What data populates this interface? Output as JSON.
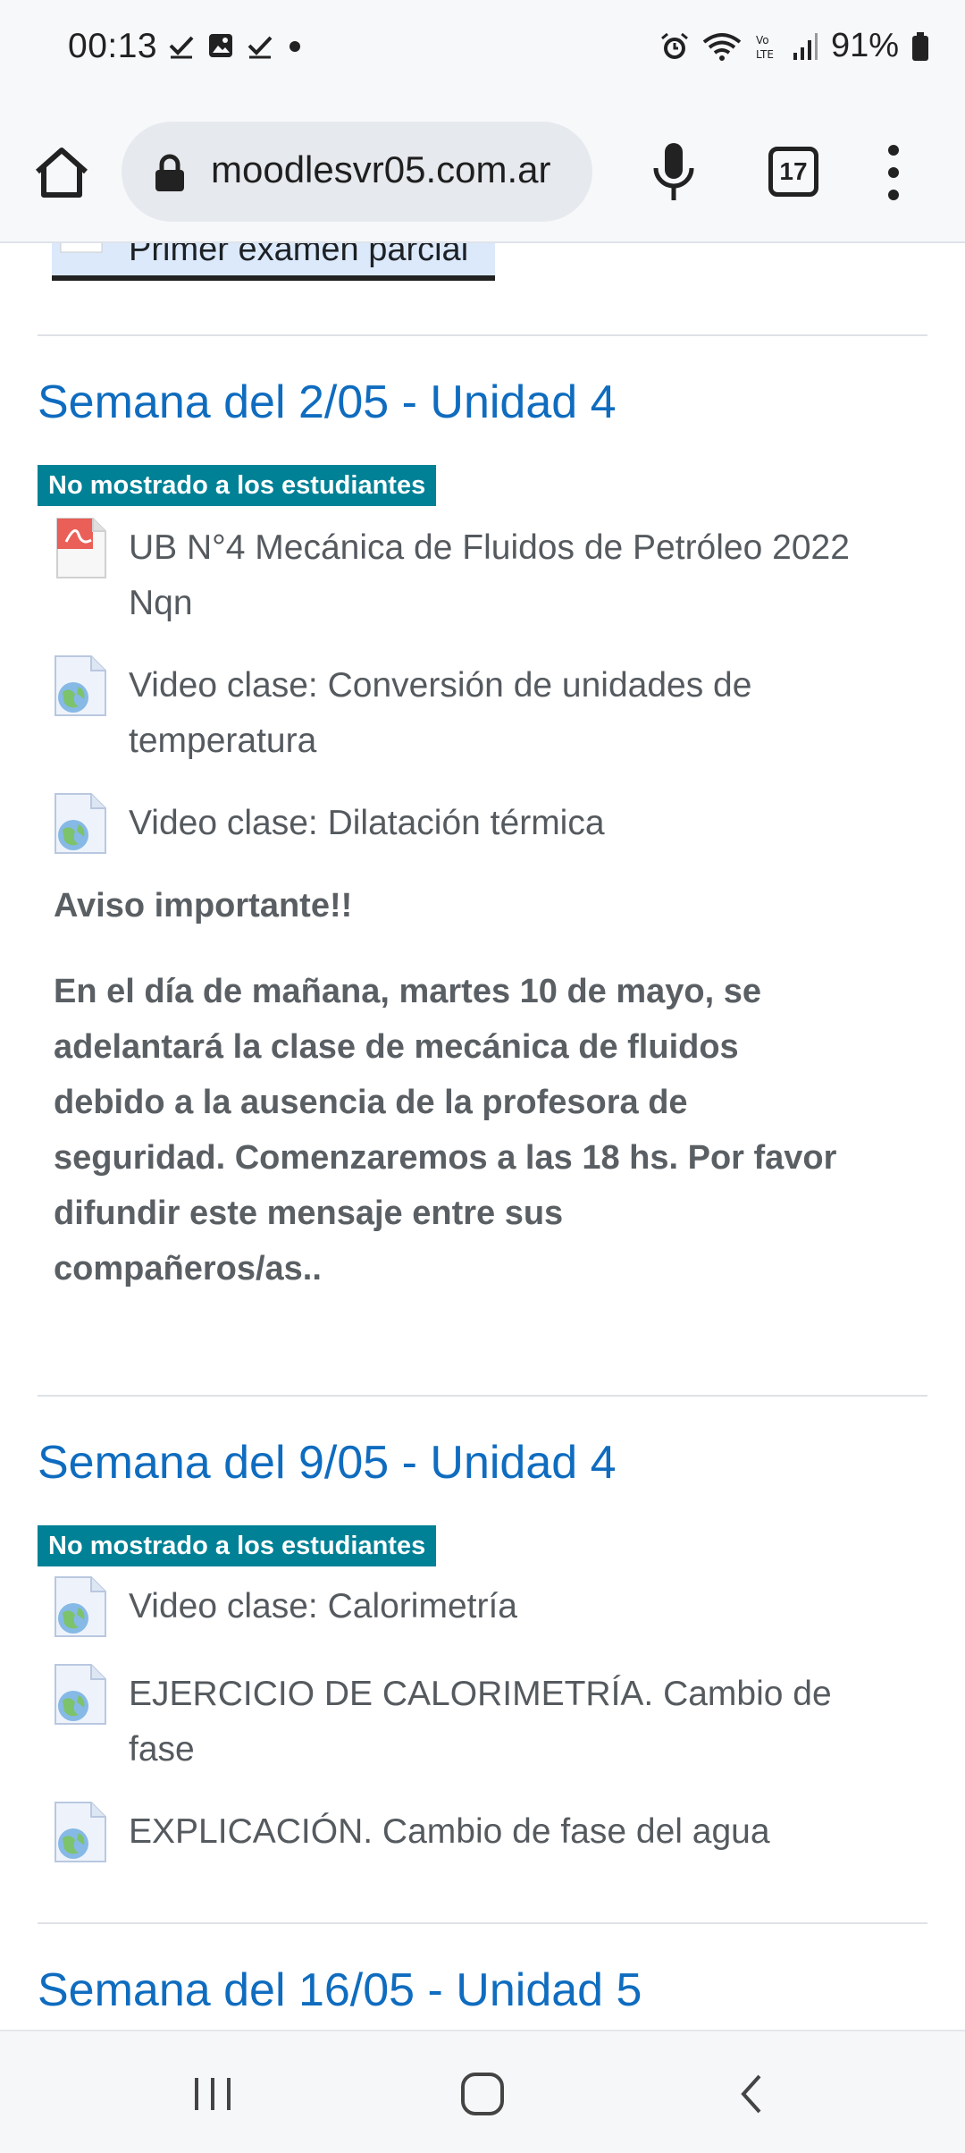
{
  "status_bar": {
    "time": "00:13",
    "battery_percent": "91%",
    "left_icons": [
      "check-icon",
      "image-icon",
      "check-icon",
      "dot-icon"
    ],
    "right_icons": [
      "alarm-icon",
      "wifi-icon",
      "volte-icon",
      "signal-icon",
      "battery-icon"
    ]
  },
  "browser": {
    "url": "moodlesvr05.com.ar",
    "tab_count": "17"
  },
  "course": {
    "previous_item": "Primer examen parcial",
    "sections": [
      {
        "title": "Semana del 2/05 - Unidad 4",
        "badge": "No mostrado a los estudiantes",
        "activities": [
          {
            "icon": "pdf-icon",
            "label": "UB N°4 Mecánica de Fluidos de Petróleo 2022 Nqn"
          },
          {
            "icon": "url-icon",
            "label": "Video clase: Conversión de unidades de temperatura"
          },
          {
            "icon": "url-icon",
            "label": "Video clase: Dilatación térmica"
          }
        ],
        "notice_title": "Aviso importante!!",
        "notice_body": "En el día de mañana, martes 10 de mayo, se adelantará la clase de mecánica de fluidos debido a la ausencia de la profesora de seguridad. Comenzaremos a las 18 hs. Por favor difundir este mensaje entre sus compañeros/as.."
      },
      {
        "title": "Semana del 9/05 - Unidad 4",
        "badge": "No mostrado a los estudiantes",
        "activities": [
          {
            "icon": "url-icon",
            "label": "Video clase: Calorimetría"
          },
          {
            "icon": "url-icon",
            "label": "EJERCICIO DE CALORIMETRÍA. Cambio de fase"
          },
          {
            "icon": "url-icon",
            "label": "EXPLICACIÓN. Cambio de fase del agua"
          }
        ]
      },
      {
        "title": "Semana del 16/05 - Unidad 5"
      }
    ]
  },
  "colors": {
    "link_blue": "#0f6cbf",
    "badge_teal": "#008196",
    "text_gray": "#555a5f"
  }
}
